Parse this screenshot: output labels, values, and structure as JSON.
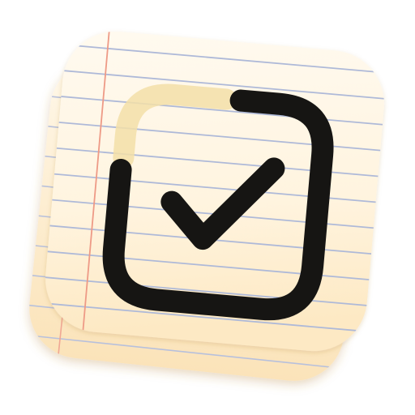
{
  "icon": {
    "kind": "app-icon",
    "symbol": "checkbox-with-checkmark",
    "layers": [
      "back-note-sheet",
      "front-note-sheet",
      "checkbox-outline",
      "checkmark"
    ],
    "colors": {
      "paper_light": "#fff7e6",
      "paper_mid": "#fdebc6",
      "paper_edge": "#f3cf95",
      "rule_line": "#aeb9d8",
      "margin_line": "#ee9a86",
      "stroke": "#161513",
      "pale_arc": "#f3dfa8"
    }
  }
}
